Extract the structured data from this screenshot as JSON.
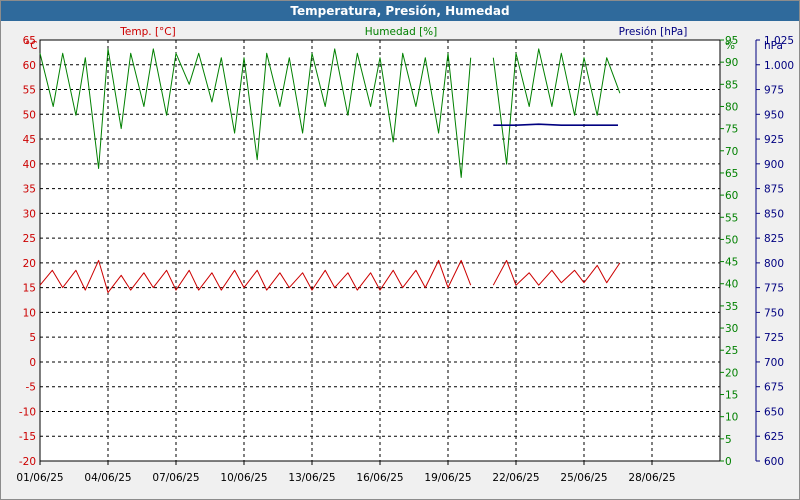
{
  "window": {
    "title": "Temperatura, Presión, Humedad"
  },
  "axis_headers": {
    "temp_unit": "°C",
    "temp_title": "Temp. [°C]",
    "hum_title": "Humedad [%]",
    "hum_unit": "%",
    "pres_title": "Presión [hPa]",
    "pres_unit": "hPa"
  },
  "colors": {
    "temperature": "#cc0000",
    "humidity": "#008000",
    "pressure": "#000080",
    "title_bar": "#2f6a9c"
  },
  "chart_data": {
    "type": "line",
    "title": "Temperatura, Presión, Humedad",
    "grid": true,
    "x_ticks": [
      "01/06/25",
      "04/06/25",
      "07/06/25",
      "10/06/25",
      "13/06/25",
      "16/06/25",
      "19/06/25",
      "22/06/25",
      "25/06/25",
      "28/06/25"
    ],
    "xlim": [
      "01/06/25",
      "30/06/25"
    ],
    "y_axes": {
      "temperature": {
        "label": "Temp. [°C]",
        "unit": "°C",
        "ylim": [
          -20,
          65
        ],
        "ticks": [
          65,
          60,
          55,
          50,
          45,
          40,
          35,
          30,
          25,
          20,
          15,
          10,
          5,
          0,
          -5,
          -10,
          -15,
          -20
        ]
      },
      "humidity": {
        "label": "Humedad [%]",
        "unit": "%",
        "ylim": [
          0,
          95
        ],
        "ticks": [
          95,
          90,
          85,
          80,
          75,
          70,
          65,
          60,
          55,
          50,
          45,
          40,
          35,
          30,
          25,
          20,
          15,
          10,
          5,
          0
        ]
      },
      "pressure": {
        "label": "Presión [hPa]",
        "unit": "hPa",
        "ylim": [
          600,
          1025
        ],
        "ticks": [
          "1.025",
          "1.000",
          "975",
          "950",
          "925",
          "900",
          "875",
          "850",
          "825",
          "800",
          "775",
          "750",
          "725",
          "700",
          "675",
          "650",
          "625",
          "600"
        ]
      }
    },
    "series": [
      {
        "name": "Temp. [°C]",
        "axis": "temperature",
        "points": [
          [
            "01/06/25 00:00",
            15.5
          ],
          [
            "01/06/25 13:00",
            18.5
          ],
          [
            "02/06/25 00:00",
            15.0
          ],
          [
            "02/06/25 14:00",
            18.5
          ],
          [
            "03/06/25 00:00",
            14.5
          ],
          [
            "03/06/25 14:00",
            20.5
          ],
          [
            "04/06/25 00:00",
            14.0
          ],
          [
            "04/06/25 14:00",
            17.5
          ],
          [
            "05/06/25 00:00",
            14.5
          ],
          [
            "05/06/25 14:00",
            18.0
          ],
          [
            "06/06/25 00:00",
            15.0
          ],
          [
            "06/06/25 14:00",
            18.5
          ],
          [
            "07/06/25 00:00",
            14.5
          ],
          [
            "07/06/25 14:00",
            18.5
          ],
          [
            "08/06/25 00:00",
            14.5
          ],
          [
            "08/06/25 14:00",
            18.0
          ],
          [
            "09/06/25 00:00",
            14.5
          ],
          [
            "09/06/25 14:00",
            18.5
          ],
          [
            "10/06/25 00:00",
            15.0
          ],
          [
            "10/06/25 14:00",
            18.5
          ],
          [
            "11/06/25 00:00",
            14.5
          ],
          [
            "11/06/25 14:00",
            18.0
          ],
          [
            "12/06/25 00:00",
            15.0
          ],
          [
            "12/06/25 14:00",
            18.0
          ],
          [
            "13/06/25 00:00",
            14.5
          ],
          [
            "13/06/25 14:00",
            18.5
          ],
          [
            "14/06/25 00:00",
            15.0
          ],
          [
            "14/06/25 14:00",
            18.0
          ],
          [
            "15/06/25 00:00",
            14.5
          ],
          [
            "15/06/25 14:00",
            18.0
          ],
          [
            "16/06/25 00:00",
            14.5
          ],
          [
            "16/06/25 14:00",
            18.5
          ],
          [
            "17/06/25 00:00",
            15.0
          ],
          [
            "17/06/25 14:00",
            18.5
          ],
          [
            "18/06/25 00:00",
            15.0
          ],
          [
            "18/06/25 14:00",
            20.5
          ],
          [
            "19/06/25 00:00",
            15.0
          ],
          [
            "19/06/25 14:00",
            20.5
          ],
          [
            "20/06/25 00:00",
            15.5
          ]
        ]
      },
      {
        "name": "Temp. [°C]",
        "axis": "temperature",
        "points": [
          [
            "21/06/25 00:00",
            15.5
          ],
          [
            "21/06/25 14:00",
            20.5
          ],
          [
            "22/06/25 00:00",
            15.5
          ],
          [
            "22/06/25 14:00",
            18.0
          ],
          [
            "23/06/25 00:00",
            15.5
          ],
          [
            "23/06/25 14:00",
            18.5
          ],
          [
            "24/06/25 00:00",
            16.0
          ],
          [
            "24/06/25 14:00",
            18.5
          ],
          [
            "25/06/25 00:00",
            16.0
          ],
          [
            "25/06/25 14:00",
            19.5
          ],
          [
            "26/06/25 00:00",
            16.0
          ],
          [
            "26/06/25 14:00",
            20.0
          ]
        ]
      },
      {
        "name": "Humedad [%]",
        "axis": "humidity",
        "points": [
          [
            "01/06/25 00:00",
            92
          ],
          [
            "01/06/25 14:00",
            80
          ],
          [
            "02/06/25 00:00",
            92
          ],
          [
            "02/06/25 14:00",
            78
          ],
          [
            "03/06/25 00:00",
            91
          ],
          [
            "03/06/25 14:00",
            66
          ],
          [
            "04/06/25 00:00",
            93
          ],
          [
            "04/06/25 14:00",
            75
          ],
          [
            "05/06/25 00:00",
            92
          ],
          [
            "05/06/25 14:00",
            80
          ],
          [
            "06/06/25 00:00",
            93
          ],
          [
            "06/06/25 14:00",
            78
          ],
          [
            "07/06/25 00:00",
            92
          ],
          [
            "07/06/25 14:00",
            85
          ],
          [
            "08/06/25 00:00",
            92
          ],
          [
            "08/06/25 14:00",
            81
          ],
          [
            "09/06/25 00:00",
            91
          ],
          [
            "09/06/25 14:00",
            74
          ],
          [
            "10/06/25 00:00",
            91
          ],
          [
            "10/06/25 14:00",
            68
          ],
          [
            "11/06/25 00:00",
            92
          ],
          [
            "11/06/25 14:00",
            80
          ],
          [
            "12/06/25 00:00",
            91
          ],
          [
            "12/06/25 14:00",
            74
          ],
          [
            "13/06/25 00:00",
            92
          ],
          [
            "13/06/25 14:00",
            80
          ],
          [
            "14/06/25 00:00",
            93
          ],
          [
            "14/06/25 14:00",
            78
          ],
          [
            "15/06/25 00:00",
            92
          ],
          [
            "15/06/25 14:00",
            80
          ],
          [
            "16/06/25 00:00",
            91
          ],
          [
            "16/06/25 14:00",
            72
          ],
          [
            "17/06/25 00:00",
            92
          ],
          [
            "17/06/25 14:00",
            80
          ],
          [
            "18/06/25 00:00",
            91
          ],
          [
            "18/06/25 14:00",
            74
          ],
          [
            "19/06/25 00:00",
            92
          ],
          [
            "19/06/25 14:00",
            64
          ],
          [
            "20/06/25 00:00",
            91
          ]
        ]
      },
      {
        "name": "Humedad [%]",
        "axis": "humidity",
        "points": [
          [
            "21/06/25 00:00",
            91
          ],
          [
            "21/06/25 14:00",
            67
          ],
          [
            "22/06/25 00:00",
            92
          ],
          [
            "22/06/25 14:00",
            80
          ],
          [
            "23/06/25 00:00",
            93
          ],
          [
            "23/06/25 14:00",
            80
          ],
          [
            "24/06/25 00:00",
            92
          ],
          [
            "24/06/25 14:00",
            78
          ],
          [
            "25/06/25 00:00",
            91
          ],
          [
            "25/06/25 14:00",
            78
          ],
          [
            "26/06/25 00:00",
            91
          ],
          [
            "26/06/25 14:00",
            83
          ]
        ]
      },
      {
        "name": "Presión [hPa]",
        "axis": "pressure",
        "points": [
          [
            "21/06/25 00:00",
            939
          ],
          [
            "22/06/25 00:00",
            939
          ],
          [
            "23/06/25 00:00",
            940
          ],
          [
            "24/06/25 00:00",
            939
          ],
          [
            "25/06/25 00:00",
            939
          ],
          [
            "26/06/25 00:00",
            939
          ],
          [
            "26/06/25 12:00",
            939
          ]
        ]
      }
    ]
  }
}
